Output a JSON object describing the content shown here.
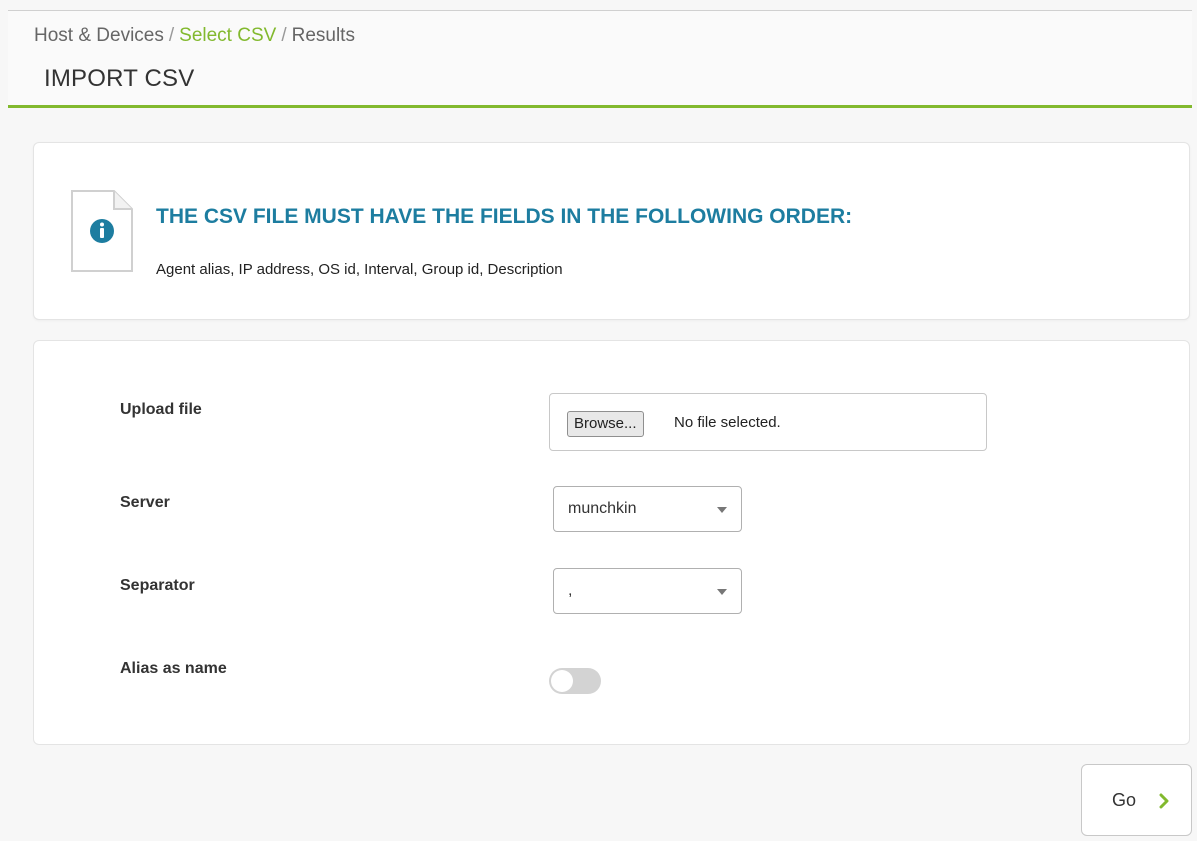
{
  "breadcrumb": {
    "items": [
      "Host & Devices",
      "Select CSV",
      "Results"
    ],
    "separator": "/"
  },
  "page_title": "IMPORT CSV",
  "info": {
    "title": "THE CSV FILE MUST HAVE THE FIELDS IN THE FOLLOWING ORDER:",
    "text": "Agent alias, IP address, OS id, Interval, Group id, Description",
    "icon": "info-icon"
  },
  "form": {
    "upload_label": "Upload file",
    "browse_label": "Browse...",
    "file_status": "No file selected.",
    "server_label": "Server",
    "server_value": "munchkin",
    "separator_label": "Separator",
    "separator_value": ",",
    "alias_label": "Alias as name",
    "alias_enabled": false
  },
  "go_button": {
    "label": "Go"
  },
  "colors": {
    "accent": "#82b92e",
    "info_title": "#1d7da0",
    "info_icon": "#1d7da0"
  }
}
